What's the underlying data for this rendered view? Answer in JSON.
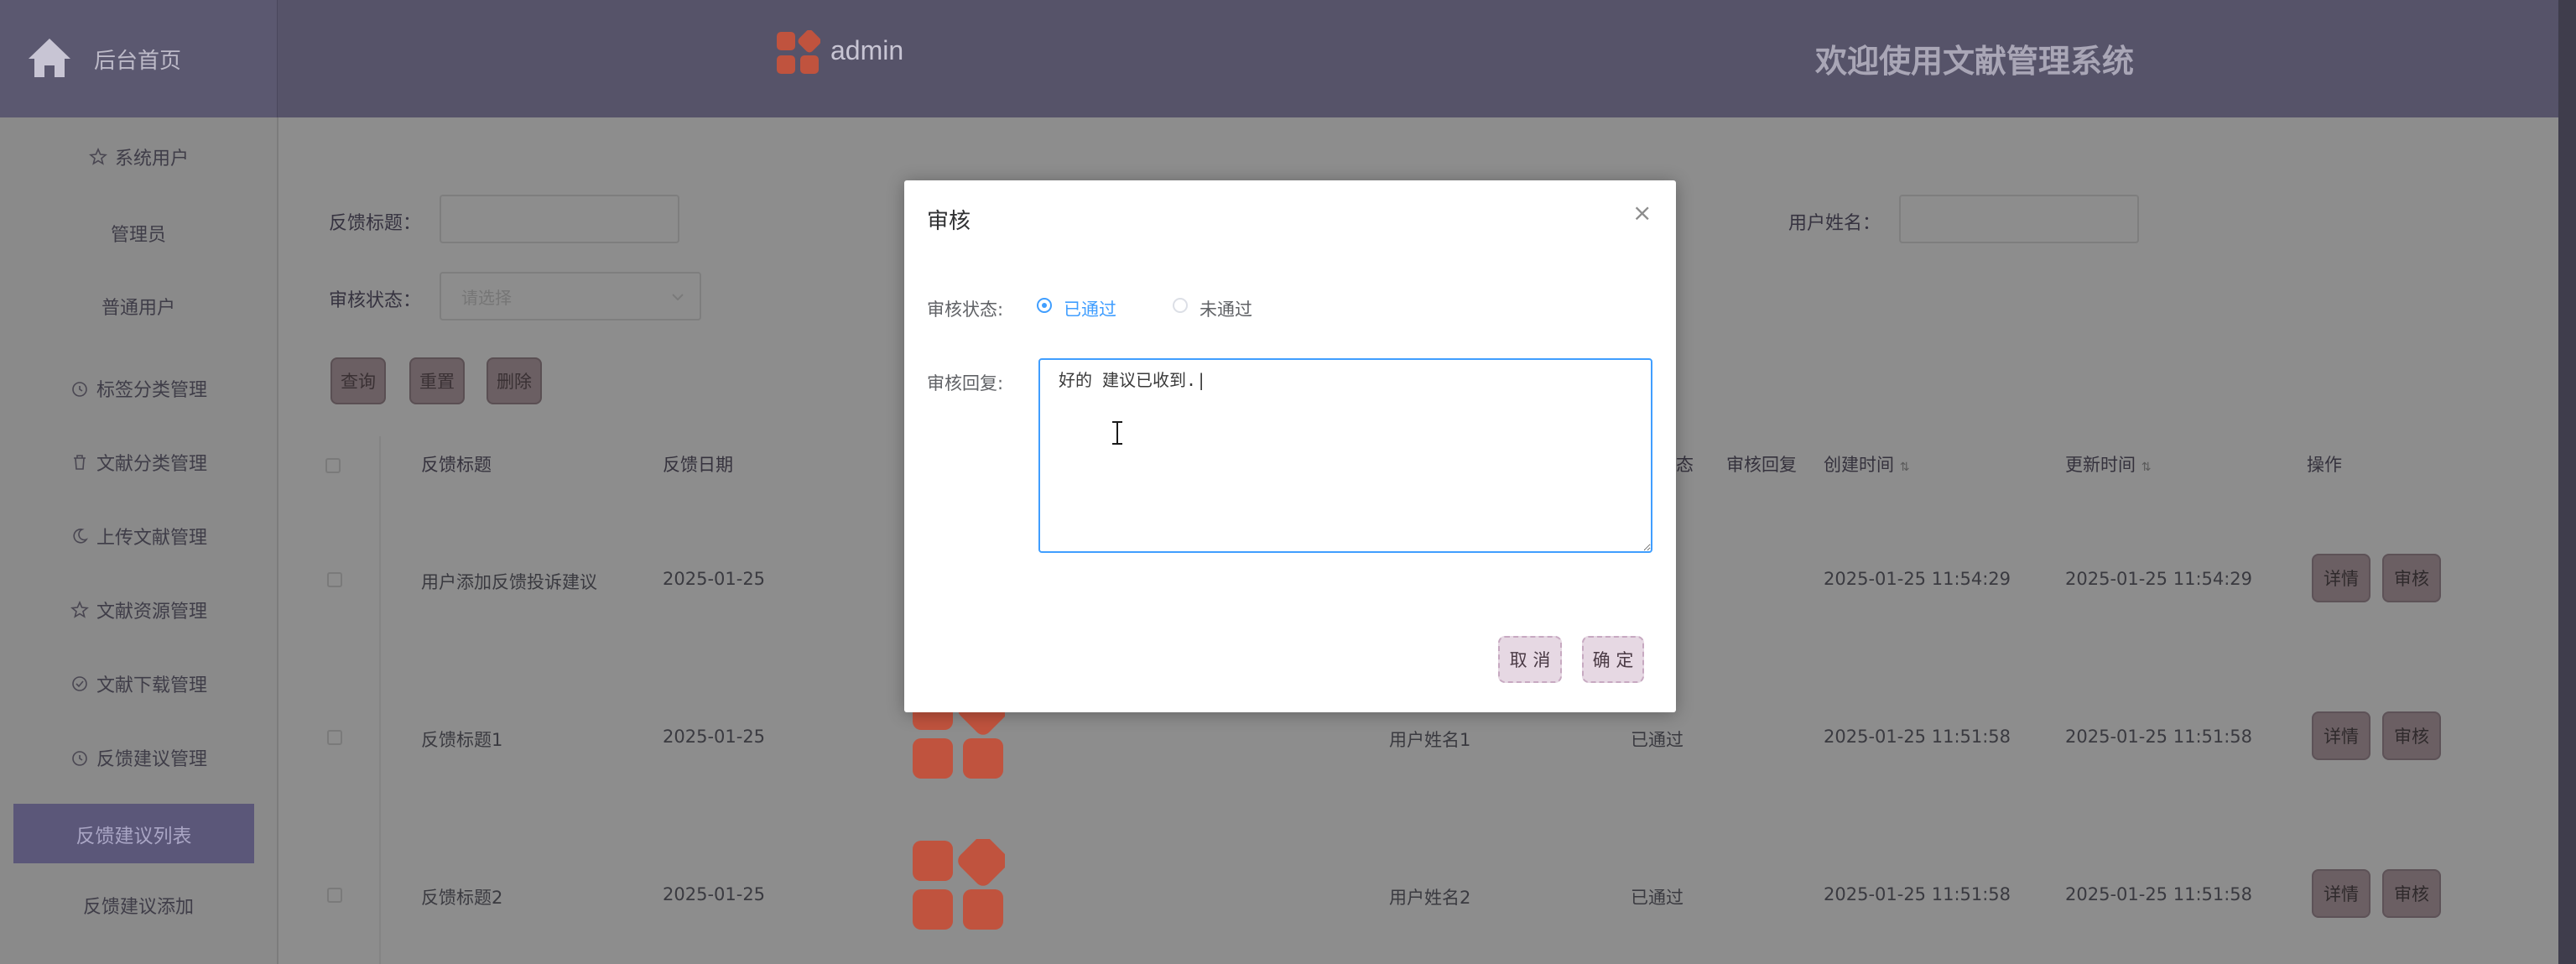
{
  "header": {
    "home_label": "后台首页",
    "username": "admin",
    "welcome": "欢迎使用文献管理系统"
  },
  "sidebar": {
    "items": [
      {
        "label": "系统用户",
        "icon": "star-icon"
      },
      {
        "label": "管理员",
        "icon": ""
      },
      {
        "label": "普通用户",
        "icon": ""
      },
      {
        "label": "标签分类管理",
        "icon": "clock-icon"
      },
      {
        "label": "文献分类管理",
        "icon": "trash-icon"
      },
      {
        "label": "上传文献管理",
        "icon": "moon-icon"
      },
      {
        "label": "文献资源管理",
        "icon": "star-icon"
      },
      {
        "label": "文献下载管理",
        "icon": "check-circle-icon"
      },
      {
        "label": "反馈建议管理",
        "icon": "clock-icon"
      },
      {
        "label": "反馈建议列表",
        "icon": "",
        "active": true
      },
      {
        "label": "反馈建议添加",
        "icon": ""
      }
    ]
  },
  "filters": {
    "title_label": "反馈标题：",
    "username_label": "用户姓名：",
    "status_label": "审核状态：",
    "status_placeholder": "请选择"
  },
  "toolbar": {
    "query": "查询",
    "reset": "重置",
    "delete": "删除"
  },
  "table": {
    "headers": {
      "title": "反馈标题",
      "date": "反馈日期",
      "status": "态",
      "reply": "审核回复",
      "created": "创建时间",
      "updated": "更新时间",
      "ops": "操作"
    },
    "rows": [
      {
        "title": "用户添加反馈投诉建议",
        "date": "2025-01-25",
        "username": "",
        "status": "",
        "created": "2025-01-25 11:54:29",
        "updated": "2025-01-25 11:54:29"
      },
      {
        "title": "反馈标题1",
        "date": "2025-01-25",
        "username": "用户姓名1",
        "status": "已通过",
        "created": "2025-01-25 11:51:58",
        "updated": "2025-01-25 11:51:58"
      },
      {
        "title": "反馈标题2",
        "date": "2025-01-25",
        "username": "用户姓名2",
        "status": "已通过",
        "created": "2025-01-25 11:51:58",
        "updated": "2025-01-25 11:51:58"
      }
    ],
    "detail_label": "详情",
    "review_label": "审核"
  },
  "modal": {
    "title": "审核",
    "close": "×",
    "status_label": "审核状态:",
    "option_pass": "已通过",
    "option_fail": "未通过",
    "selected": "已通过",
    "reply_label": "审核回复:",
    "reply_value": "好的 建议已收到.|",
    "cancel": "取 消",
    "confirm": "确 定"
  },
  "colors": {
    "header_bg": "#565369",
    "accent_blue": "#409eff",
    "thumb_red": "#c0533e",
    "active_menu": "#5b5779"
  }
}
